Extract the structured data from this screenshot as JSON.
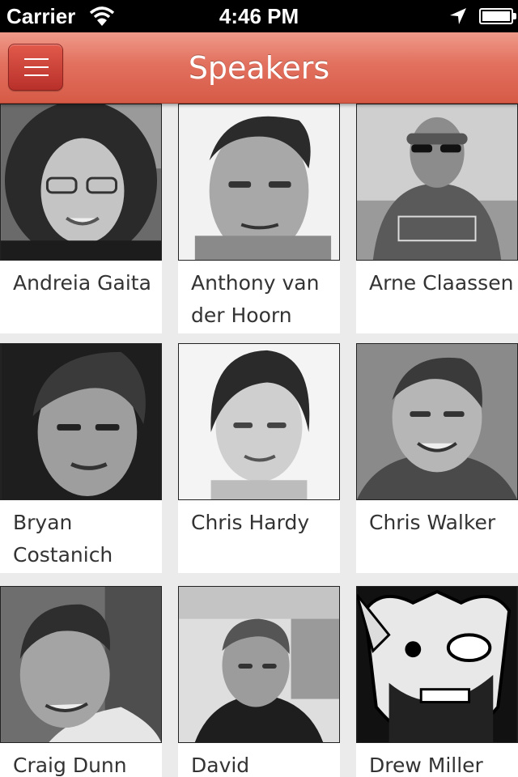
{
  "status_bar": {
    "carrier": "Carrier",
    "time": "4:46 PM",
    "icons": [
      "wifi-icon",
      "location-arrow-icon",
      "battery-icon"
    ]
  },
  "nav": {
    "title": "Speakers",
    "menu_icon": "hamburger-menu-icon",
    "accent_color": "#e2705e"
  },
  "speakers": [
    {
      "name": "Andreia Gaita"
    },
    {
      "name": "Anthony van der Hoorn"
    },
    {
      "name": "Arne Claassen"
    },
    {
      "name": "Bryan Costanich"
    },
    {
      "name": "Chris Hardy"
    },
    {
      "name": "Chris Walker"
    },
    {
      "name": "Craig Dunn"
    },
    {
      "name": "David"
    },
    {
      "name": "Drew Miller"
    }
  ]
}
